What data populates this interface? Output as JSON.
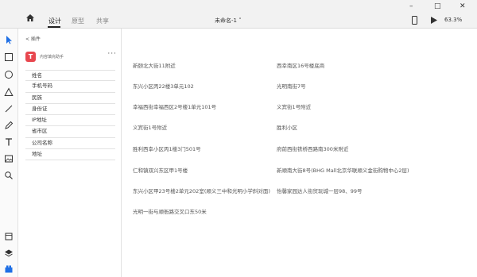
{
  "topbar": {
    "tabs": [
      {
        "label": "设计",
        "active": true
      },
      {
        "label": "原型",
        "active": false
      },
      {
        "label": "共享",
        "active": false
      }
    ],
    "doc_title": "未命名-1 ˅",
    "zoom": "63.3%",
    "window_controls": {
      "minimize": "–",
      "maximize": "□",
      "close": "✕"
    }
  },
  "left_toolbar": {
    "icons": [
      "pointer-icon",
      "rectangle-icon",
      "ellipse-icon",
      "triangle-icon",
      "line-icon",
      "pen-icon",
      "text-icon",
      "image-icon",
      "zoom-icon",
      "pages-icon",
      "layers-icon",
      "components-icon"
    ]
  },
  "panel": {
    "breadcrumb": "<  插件",
    "plugin": {
      "logo_letter": "T",
      "name": "内容填充助手",
      "more": "···"
    },
    "fields": [
      "姓名",
      "手机号码",
      "民族",
      "身份证",
      "IP地址",
      "省市区",
      "公司名称",
      "地址"
    ]
  },
  "canvas": {
    "addresses_left": [
      "新颐北大街11附近",
      "东兴小区丙22楼3单元102",
      "幸福西街幸福西区2号楼1单元101号",
      "义宾街1号附近",
      "胜利西幸小区丙1楼3门501号",
      "仁和镇双兴东区甲1号楼",
      "东兴小区甲23号楼2单元202室(顺义三中和光明小学斜对面)",
      "光明一街与顺衙路交叉口东50米"
    ],
    "addresses_right": [
      "西幸南区16号楼底商",
      "光明南街7号",
      "义宾街1号附近",
      "胜利小区",
      "府前西街铁桥西路南300米附近",
      "新顺南大街8号(BHG Mall北京华联顺义金街购物中心2层)",
      "怡馨家园达人街贸玩城一层98、99号"
    ]
  },
  "colors": {
    "accent": "#e8474f",
    "topbar_bg": "#f2f2f2",
    "selected_tool": "#1f6fe5"
  }
}
